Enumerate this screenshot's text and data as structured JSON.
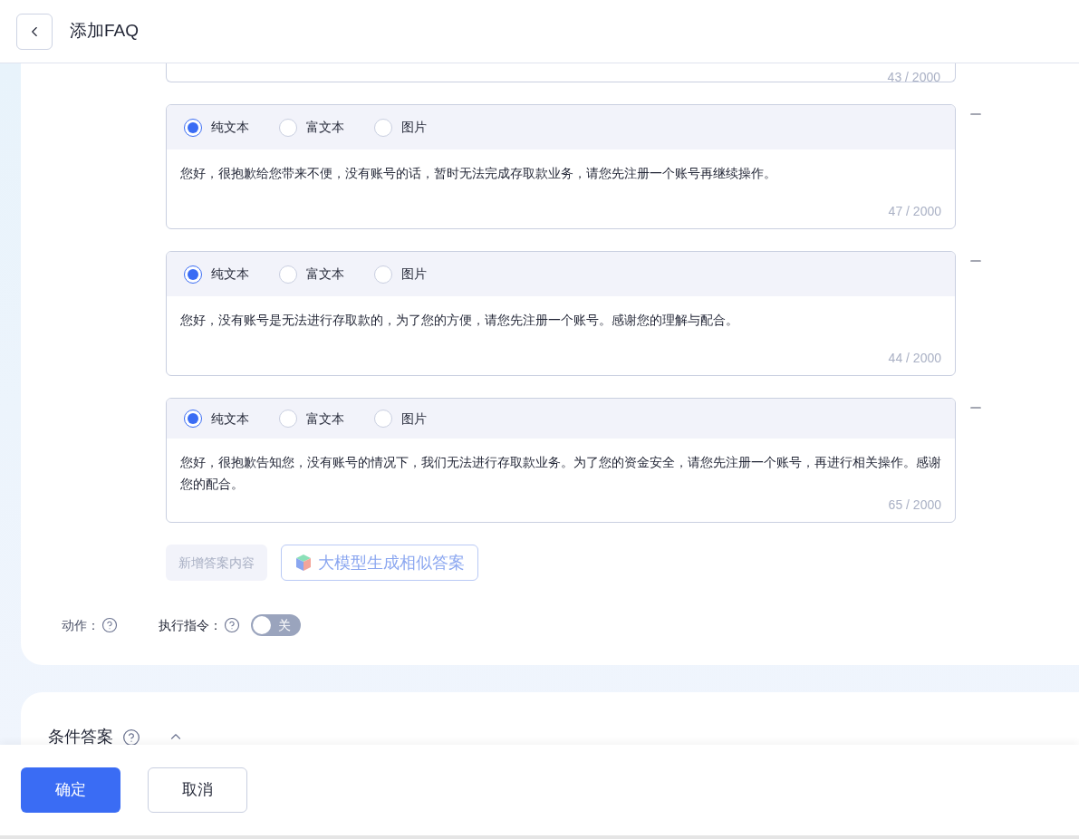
{
  "header": {
    "title": "添加FAQ"
  },
  "previous_answer": {
    "count": "43 / 2000"
  },
  "answers": [
    {
      "types": [
        {
          "label": "纯文本",
          "selected": true
        },
        {
          "label": "富文本",
          "selected": false
        },
        {
          "label": "图片",
          "selected": false
        }
      ],
      "text": "您好，很抱歉给您带来不便，没有账号的话，暂时无法完成存取款业务，请您先注册一个账号再继续操作。",
      "count": "47 / 2000"
    },
    {
      "types": [
        {
          "label": "纯文本",
          "selected": true
        },
        {
          "label": "富文本",
          "selected": false
        },
        {
          "label": "图片",
          "selected": false
        }
      ],
      "text": "您好，没有账号是无法进行存取款的，为了您的方便，请您先注册一个账号。感谢您的理解与配合。",
      "count": "44 / 2000"
    },
    {
      "types": [
        {
          "label": "纯文本",
          "selected": true
        },
        {
          "label": "富文本",
          "selected": false
        },
        {
          "label": "图片",
          "selected": false
        }
      ],
      "text": "您好，很抱歉告知您，没有账号的情况下，我们无法进行存取款业务。为了您的资金安全，请您先注册一个账号，再进行相关操作。感谢您的配合。",
      "count": "65 / 2000"
    }
  ],
  "add_button": {
    "label": "新增答案内容",
    "disabled": true
  },
  "generate_button": {
    "label": "大模型生成相似答案"
  },
  "action": {
    "label": "动作：",
    "command_label": "执行指令：",
    "toggle": {
      "on": false,
      "label": "关"
    }
  },
  "condition_section": {
    "title": "条件答案",
    "expanded": true
  },
  "footer": {
    "confirm": "确定",
    "cancel": "取消"
  }
}
